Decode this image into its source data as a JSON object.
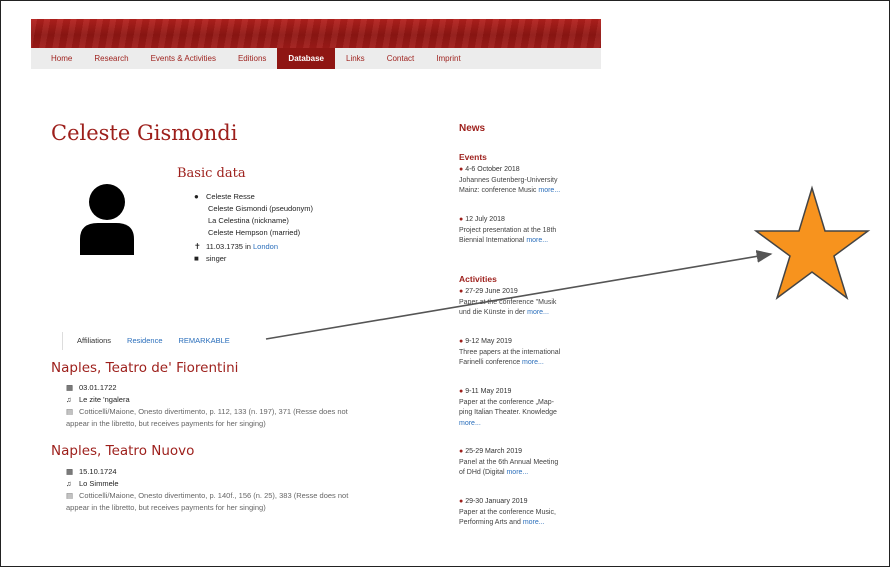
{
  "nav": {
    "items": [
      {
        "label": "Home"
      },
      {
        "label": "Research"
      },
      {
        "label": "Events & Activities"
      },
      {
        "label": "Editions"
      },
      {
        "label": "Database",
        "active": true
      },
      {
        "label": "Links"
      },
      {
        "label": "Contact"
      },
      {
        "label": "Imprint"
      }
    ]
  },
  "person": {
    "name": "Celeste Gismondi",
    "avatar_icon": "user-silhouette-icon",
    "basic_heading": "Basic data",
    "names": {
      "primary": "Celeste Resse",
      "alt1": "Celeste Gismondi (pseudonym)",
      "alt2": "La Celestina (nickname)",
      "alt3": "Celeste Hempson (married)"
    },
    "death_date": "11.03.1735 in ",
    "death_place": "London",
    "occupation": "singer"
  },
  "tabs": {
    "affiliations": "Affiliations",
    "residence": "Residence",
    "remarkable": "REMARKABLE"
  },
  "affiliations": [
    {
      "place": "Naples, Teatro de' Fiorentini",
      "date": "03.01.1722",
      "work": "Le zite 'ngalera",
      "source_line1": "Cotticelli/Maione, Onesto divertimento, p. 112, 133 (n. 197), 371 (Resse does not",
      "source_line2": "appear in the libretto, but receives payments for her singing)"
    },
    {
      "place": "Naples, Teatro Nuovo",
      "date": "15.10.1724",
      "work": "Lo Simmele",
      "source_line1": "Cotticelli/Maione, Onesto divertimento, p. 140f., 156 (n. 25), 383 (Resse does not",
      "source_line2": "appear in the libretto, but receives payments for her singing)"
    }
  ],
  "news": {
    "title": "News",
    "events_title": "Events",
    "activities_title": "Activities",
    "more": "more...",
    "events": [
      {
        "date": "4-6 October 2018",
        "l1": "Johannes Gutenberg-University",
        "l2": "Mainz: conference Music "
      },
      {
        "date": "12 July 2018",
        "l1": "Project presentation at the 18th",
        "l2": "Biennial International "
      }
    ],
    "activities": [
      {
        "date": "27-29 June 2019",
        "l1": "Paper at the conference \"Musik",
        "l2": "und die Künste in der "
      },
      {
        "date": "9-12 May 2019",
        "l1": "Three papers at the international",
        "l2": "Farinelli conference "
      },
      {
        "date": "9-11 May 2019",
        "l1": "Paper at the conference „Map-",
        "l2": "ping Italian Theater. Knowledge"
      },
      {
        "date": "25-29 March 2019",
        "l1": "Panel at the 6th Annual Meeting",
        "l2": "of DHd (Digital "
      },
      {
        "date": "29-30 January 2019",
        "l1": "Paper at the conference Music,",
        "l2": "Performing Arts and "
      }
    ]
  },
  "annotation": {
    "shape": "star",
    "fill": "#f7931e",
    "stroke": "#444444",
    "arrow_color": "#555555"
  },
  "colors": {
    "brand": "#9d1f1b",
    "link": "#2a6ebb"
  }
}
